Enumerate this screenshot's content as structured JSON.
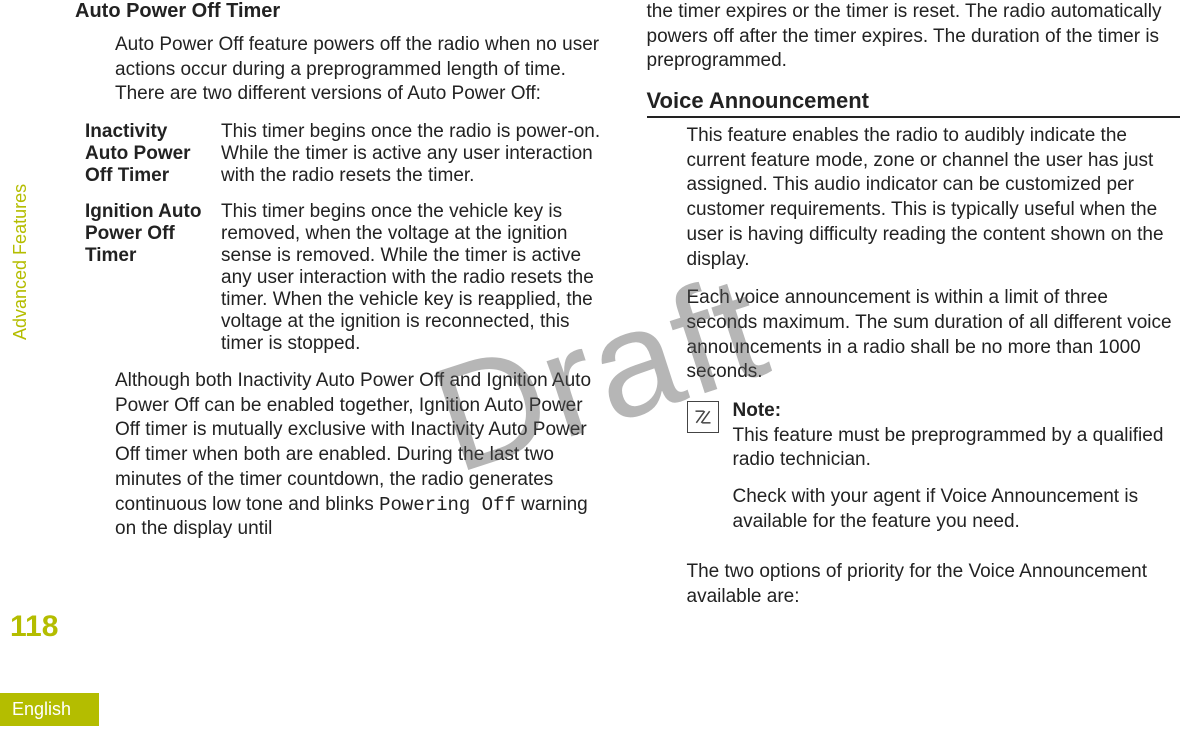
{
  "sidebar_label": "Advanced Features",
  "page_number": "118",
  "language": "English",
  "watermark": "Draft",
  "left": {
    "heading": "Auto Power Off Timer",
    "intro": "Auto Power Off feature powers off the radio when no user actions occur during a preprogrammed length of time. There are two different versions of Auto Power Off:",
    "defs": [
      {
        "term": "Inactivity Auto Power Off Timer",
        "desc": "This timer begins once the radio is power-on. While the timer is active any user interaction with the radio resets the timer."
      },
      {
        "term": "Ignition Auto Power Off Timer",
        "desc": "This timer begins once the vehicle key is removed, when the voltage at the ignition sense is removed. While the timer is active any user interaction with the radio resets the timer. When the vehicle key is reapplied, the voltage at the ignition is reconnected, this timer is stopped."
      }
    ],
    "closing_before": "Although both Inactivity Auto Power Off and Ignition Auto Power Off can be enabled together, Ignition Auto Power Off timer is mutually exclusive with Inactivity Auto Power Off timer when both are enabled. During the last two minutes of the timer countdown, the radio generates continuous low tone and blinks ",
    "closing_mono": "Powering Off",
    "closing_after": " warning on the display until "
  },
  "right": {
    "continuation": "the timer expires or the timer is reset. The radio automatically powers off after the timer expires. The duration of the timer is preprogrammed.",
    "section_heading": "Voice Announcement",
    "para1": "This feature enables the radio to audibly indicate the current feature mode, zone or channel the user has just assigned. This audio indicator can be customized per customer requirements. This is typically useful when the user is having difficulty reading the content shown on the display.",
    "para2": "Each voice announcement is within a limit of three seconds maximum. The sum duration of all different voice announcements in a radio shall be no more than 1000 seconds.",
    "note_title": "Note:",
    "note_line1": "This feature must be preprogrammed by a qualified radio technician.",
    "note_line2": "Check with your agent if Voice Announcement is available for the feature you need.",
    "para3": "The two options of priority for the Voice Announcement available are:"
  }
}
